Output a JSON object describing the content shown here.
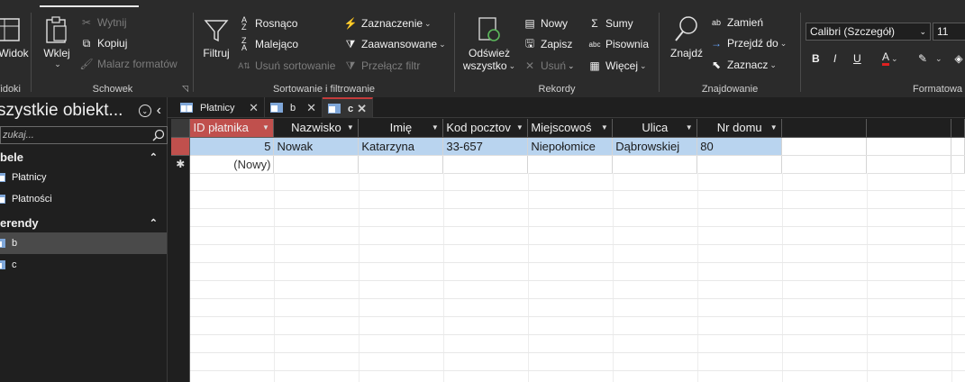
{
  "ribbon": {
    "view": {
      "label": "Widoki",
      "button": "Widok"
    },
    "clipboard": {
      "label": "Schowek",
      "paste": "Wklej",
      "cut": "Wytnij",
      "copy": "Kopiuj",
      "format_painter": "Malarz formatów"
    },
    "sort_filter": {
      "label": "Sortowanie i filtrowanie",
      "filter": "Filtruj",
      "ascending": "Rosnąco",
      "descending": "Malejąco",
      "remove_sort": "Usuń sortowanie",
      "selection": "Zaznaczenie",
      "advanced": "Zaawansowane",
      "toggle_filter": "Przełącz filtr"
    },
    "records": {
      "label": "Rekordy",
      "refresh": "Odśwież",
      "refresh2": "wszystko",
      "new": "Nowy",
      "save": "Zapisz",
      "delete": "Usuń",
      "totals": "Sumy",
      "spelling": "Pisownia",
      "more": "Więcej"
    },
    "find": {
      "label": "Znajdowanie",
      "find": "Znajdź",
      "replace": "Zamień",
      "goto": "Przejdź do",
      "select": "Zaznacz"
    },
    "formatting": {
      "label": "Formatowa",
      "font": "Calibri (Szczegół)",
      "size": "11",
      "bold": "B",
      "italic": "I",
      "underline": "U",
      "font_color": "A"
    }
  },
  "nav": {
    "title": "szystkie obiekt...",
    "search_placeholder": "zukaj...",
    "sections": [
      {
        "name": "bele",
        "items": [
          "Płatnicy",
          "Płatności"
        ]
      },
      {
        "name": "erendy",
        "items": [
          "b",
          "c"
        ]
      }
    ],
    "selected": "b"
  },
  "doc_tabs": [
    {
      "label": "Płatnicy"
    },
    {
      "label": "b"
    },
    {
      "label": "c"
    }
  ],
  "datasheet": {
    "columns": [
      "ID płatnika",
      "Nazwisko",
      "Imię",
      "Kod pocztov",
      "Miejscowoś",
      "Ulica",
      "Nr domu"
    ],
    "rows": [
      [
        "5",
        "Nowak",
        "Katarzyna",
        "33-657",
        "Niepołomice",
        "Dąbrowskiej",
        "80"
      ]
    ],
    "new_row_label": "(Nowy)",
    "new_row_marker": "✱"
  },
  "colors": {
    "accent_red": "#c0504d",
    "row_highlight": "#b9d4ef",
    "ribbon_bg": "#2b2b2b",
    "pane_bg": "#1f1f1f"
  }
}
